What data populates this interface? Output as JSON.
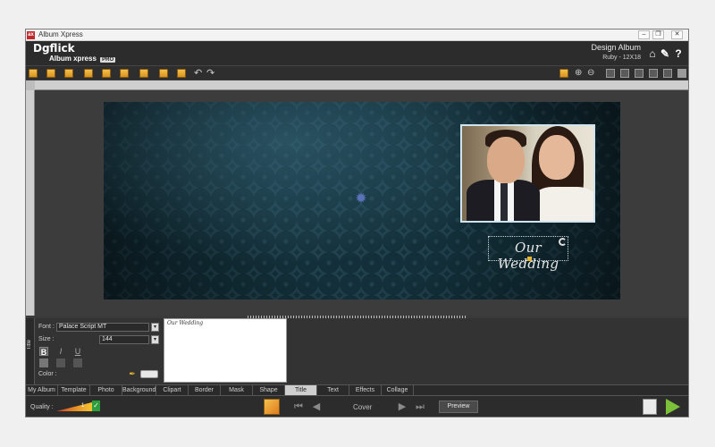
{
  "window": {
    "title": "Album Xpress",
    "buttons": [
      "–",
      "❐",
      "✕"
    ]
  },
  "header": {
    "logo": "Dgflick",
    "product": "Album xpress",
    "badge": "PRO",
    "section_title": "Design Album",
    "album_spec": "Ruby - 12X18",
    "icons": [
      "home-icon",
      "wrench-icon",
      "help-icon"
    ]
  },
  "canvas": {
    "title_text": "Our Wedding"
  },
  "panel": {
    "side_label": "Title",
    "font_label": "Font :",
    "font_value": "Palace Script MT",
    "size_label": "Size :",
    "size_value": "144",
    "format": {
      "bold": "B",
      "italic": "I",
      "underline": "U"
    },
    "color_label": "Color :",
    "color_value": "#e8e8e8",
    "preview_text": "Our Wedding"
  },
  "tabs": [
    "My Album",
    "Template",
    "Photo",
    "Background",
    "Clipart",
    "Border",
    "Mask",
    "Shape",
    "Title",
    "Text",
    "Effects",
    "Collage"
  ],
  "active_tab": "Title",
  "status": {
    "quality_label": "Quality :",
    "quality_value": "1",
    "page_label": "Cover",
    "preview_button": "Preview"
  }
}
